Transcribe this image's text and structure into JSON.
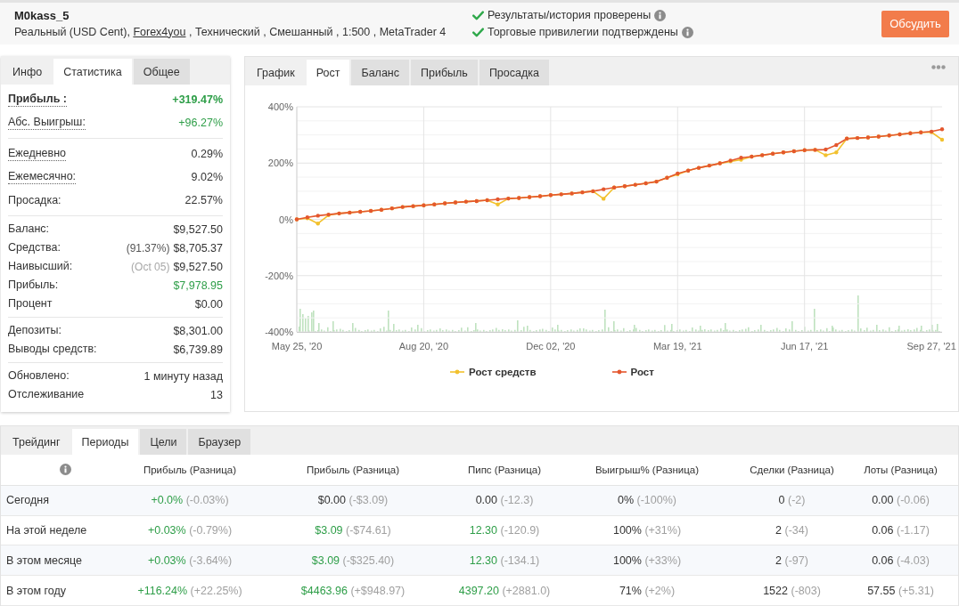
{
  "header": {
    "account_name": "M0kass_5",
    "details_before": "Реальный (USD Cent),",
    "broker": "Forex4you",
    "details_after": ", Технический , Смешанный , 1:500 , MetaTrader 4",
    "verifications": [
      {
        "text": "Результаты/история проверены",
        "verified": true
      },
      {
        "text": "Торговые привилегии подтверждены",
        "verified": true
      }
    ],
    "action_button": "Обсудить"
  },
  "stats_panel": {
    "tabs": [
      {
        "label": "Инфо",
        "kind": "plain",
        "selected": false
      },
      {
        "label": "Статистика",
        "kind": "boxed",
        "selected": true
      },
      {
        "label": "Общее",
        "kind": "boxed",
        "selected": false
      }
    ],
    "groups": [
      {
        "rows": [
          {
            "label": "Прибыль :",
            "value": "+319.47%",
            "positive": true,
            "hint": true,
            "strong": true
          },
          {
            "label": "Абс. Выигрыш:",
            "value": "+96.27%",
            "positive": true,
            "hint": true,
            "strong": false
          }
        ]
      },
      {
        "rows": [
          {
            "label": "Ежедневно",
            "value": "0.29%",
            "positive": false,
            "hint": true,
            "strong": false
          },
          {
            "label": "Ежемесячно:",
            "value": "9.02%",
            "positive": false,
            "hint": true,
            "strong": false
          },
          {
            "label": "Просадка:",
            "value": "22.57%",
            "positive": false,
            "hint": false,
            "strong": false
          }
        ]
      },
      {
        "rows": [
          {
            "label": "Баланс:",
            "value": "$9,527.50",
            "positive": false,
            "hint": false,
            "strong": false
          },
          {
            "label": "Средства:",
            "note": "(91.37%)",
            "note_muted": false,
            "value": "$8,705.37",
            "positive": false,
            "hint": false,
            "strong": false
          },
          {
            "label": "Наивысший:",
            "note": "(Oct 05)",
            "note_muted": true,
            "value": "$9,527.50",
            "positive": false,
            "hint": false,
            "strong": false
          },
          {
            "label": "Прибыль:",
            "value": "$7,978.95",
            "positive": true,
            "hint": false,
            "strong": false
          },
          {
            "label": "Процент",
            "value": "$0.00",
            "positive": false,
            "hint": false,
            "strong": false
          }
        ]
      },
      {
        "rows": [
          {
            "label": "Депозиты:",
            "value": "$8,301.00",
            "positive": false,
            "hint": false,
            "strong": false
          },
          {
            "label": "Выводы средств:",
            "value": "$6,739.89",
            "positive": false,
            "hint": false,
            "strong": false
          }
        ]
      },
      {
        "rows": [
          {
            "label": "Обновлено:",
            "value": "1 минуту назад",
            "positive": false,
            "hint": false,
            "strong": false
          },
          {
            "label": "Отслеживание",
            "value": "13",
            "positive": false,
            "hint": false,
            "strong": false
          }
        ]
      }
    ]
  },
  "chart_panel": {
    "tabs": [
      {
        "label": "График",
        "kind": "plain",
        "selected": false
      },
      {
        "label": "Рост",
        "kind": "boxed",
        "selected": true
      },
      {
        "label": "Баланс",
        "kind": "boxed",
        "selected": false
      },
      {
        "label": "Прибыль",
        "kind": "boxed",
        "selected": false
      },
      {
        "label": "Просадка",
        "kind": "boxed",
        "selected": false
      }
    ],
    "chart_data": {
      "type": "line",
      "categories": [
        "May 25, '20",
        null,
        null,
        null,
        null,
        null,
        null,
        null,
        null,
        null,
        null,
        null,
        "Aug 20, '20",
        null,
        null,
        null,
        null,
        null,
        null,
        null,
        null,
        null,
        null,
        null,
        "Dec 02, '20",
        null,
        null,
        null,
        null,
        null,
        null,
        null,
        null,
        null,
        null,
        null,
        "Mar 19, '21",
        null,
        null,
        null,
        null,
        null,
        null,
        null,
        null,
        null,
        null,
        null,
        "Jun 17, '21",
        null,
        null,
        null,
        null,
        null,
        null,
        null,
        null,
        null,
        null,
        null,
        "Sep 27, '21",
        null
      ],
      "ylim": [
        -400,
        400
      ],
      "yticks": [
        {
          "value": -400,
          "label": "-400%"
        },
        {
          "value": -200,
          "label": "-200%"
        },
        {
          "value": 0,
          "label": "0%"
        },
        {
          "value": 200,
          "label": "200%"
        },
        {
          "value": 400,
          "label": "400%"
        }
      ],
      "grid": true,
      "legend": "bottom",
      "series": [
        {
          "name": "Рост средств",
          "color": "#f2c12e",
          "values": [
            0,
            4,
            -15,
            15,
            21,
            24,
            27,
            30,
            34,
            39,
            44,
            47,
            50,
            53,
            57,
            60,
            63,
            65,
            68,
            53,
            74,
            76,
            79,
            82,
            86,
            89,
            92,
            96,
            100,
            73,
            113,
            118,
            123,
            128,
            134,
            148,
            160,
            173,
            183,
            191,
            199,
            206,
            212,
            223,
            228,
            233,
            238,
            242,
            246,
            247,
            228,
            238,
            287,
            289,
            291,
            294,
            298,
            302,
            306,
            309,
            310,
            283
          ]
        },
        {
          "name": "Рост",
          "color": "#e4572e",
          "values": [
            0,
            7,
            13,
            17,
            21,
            24,
            27,
            30,
            34,
            39,
            44,
            47,
            50,
            53,
            57,
            60,
            63,
            65,
            68,
            71,
            74,
            76,
            79,
            82,
            86,
            89,
            92,
            96,
            100,
            107,
            113,
            118,
            123,
            128,
            134,
            148,
            163,
            173,
            183,
            191,
            199,
            209,
            219,
            223,
            228,
            233,
            238,
            242,
            246,
            247,
            248,
            264,
            287,
            289,
            291,
            294,
            298,
            302,
            306,
            309,
            312,
            320
          ]
        }
      ]
    }
  },
  "periods_panel": {
    "tabs": [
      {
        "label": "Трейдинг",
        "kind": "plain",
        "selected": false
      },
      {
        "label": "Периоды",
        "kind": "boxed",
        "selected": true
      },
      {
        "label": "Цели",
        "kind": "boxed",
        "selected": false
      },
      {
        "label": "Браузер",
        "kind": "boxed",
        "selected": false
      }
    ],
    "table": {
      "columns": [
        "Прибыль (Разница)",
        "Прибыль (Разница)",
        "Пипс (Разница)",
        "Выигрыш% (Разница)",
        "Сделки (Разница)",
        "Лоты (Разница)"
      ],
      "rows": [
        {
          "label": "Сегодня",
          "cells": [
            {
              "value": "+0.0%",
              "change": "(-0.03%)",
              "positive": true
            },
            {
              "value": "$0.00",
              "change": "(-$3.09)",
              "positive": false
            },
            {
              "value": "0.00",
              "change": "(-12.3)",
              "positive": false
            },
            {
              "value": "0%",
              "change": "(-100%)",
              "positive": false
            },
            {
              "value": "0",
              "change": "(-2)",
              "positive": false
            },
            {
              "value": "0.00",
              "change": "(-0.06)",
              "positive": false
            }
          ]
        },
        {
          "label": "На этой неделе",
          "cells": [
            {
              "value": "+0.03%",
              "change": "(-0.79%)",
              "positive": true
            },
            {
              "value": "$3.09",
              "change": "(-$74.61)",
              "positive": true
            },
            {
              "value": "12.30",
              "change": "(-120.9)",
              "positive": true
            },
            {
              "value": "100%",
              "change": "(+31%)",
              "positive": false
            },
            {
              "value": "2",
              "change": "(-34)",
              "positive": false
            },
            {
              "value": "0.06",
              "change": "(-1.17)",
              "positive": false
            }
          ]
        },
        {
          "label": "В этом месяце",
          "cells": [
            {
              "value": "+0.03%",
              "change": "(-3.64%)",
              "positive": true
            },
            {
              "value": "$3.09",
              "change": "(-$325.40)",
              "positive": true
            },
            {
              "value": "12.30",
              "change": "(-134.1)",
              "positive": true
            },
            {
              "value": "100%",
              "change": "(+33%)",
              "positive": false
            },
            {
              "value": "2",
              "change": "(-97)",
              "positive": false
            },
            {
              "value": "0.06",
              "change": "(-4.03)",
              "positive": false
            }
          ]
        },
        {
          "label": "В этом году",
          "cells": [
            {
              "value": "+116.24%",
              "change": "(+22.25%)",
              "positive": true
            },
            {
              "value": "$4463.96",
              "change": "(+$948.97)",
              "positive": true
            },
            {
              "value": "4397.20",
              "change": "(+2881.0)",
              "positive": true
            },
            {
              "value": "71%",
              "change": "(+2%)",
              "positive": false
            },
            {
              "value": "1522",
              "change": "(-803)",
              "positive": false
            },
            {
              "value": "57.55",
              "change": "(+5.31)",
              "positive": false
            }
          ]
        }
      ]
    }
  }
}
